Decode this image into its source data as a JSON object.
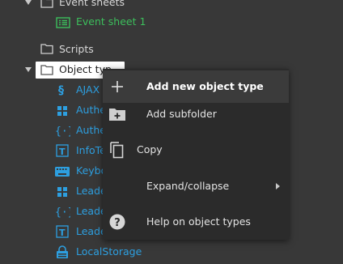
{
  "tree": {
    "event_sheets_label": "Event sheets",
    "event_sheet_1_label": "Event sheet 1",
    "scripts_label": "Scripts",
    "object_types_label": "Object types",
    "object_types_truncated": "Object typ",
    "objects": [
      {
        "label": "AJAX",
        "icon": "ajax-icon"
      },
      {
        "label": "Authe",
        "icon": "plugin-icon"
      },
      {
        "label": "Authe",
        "icon": "brackets-icon"
      },
      {
        "label": "InfoTe",
        "icon": "text-icon"
      },
      {
        "label": "Keybo",
        "icon": "keyboard-icon"
      },
      {
        "label": "Leade",
        "icon": "grid-icon"
      },
      {
        "label": "Leade",
        "icon": "brackets-icon"
      },
      {
        "label": "Leade",
        "icon": "text-icon"
      },
      {
        "label": "LocalStorage",
        "icon": "localstorage-icon"
      }
    ]
  },
  "context_menu": {
    "items": [
      {
        "label": "Add new object type",
        "icon": "plus-icon"
      },
      {
        "label": "Add subfolder",
        "icon": "folder-add-icon"
      },
      {
        "label": "Copy",
        "icon": "copy-icon"
      },
      {
        "label": "Expand/collapse",
        "icon": ""
      },
      {
        "label": "Help on object types",
        "icon": "help-icon"
      }
    ]
  },
  "colors": {
    "background": "#383838",
    "menu_background": "#2b2b2b",
    "menu_hover": "#3b3b3b",
    "object_label": "#2d9fe0",
    "event_sheet_label": "#3cbf5c"
  }
}
